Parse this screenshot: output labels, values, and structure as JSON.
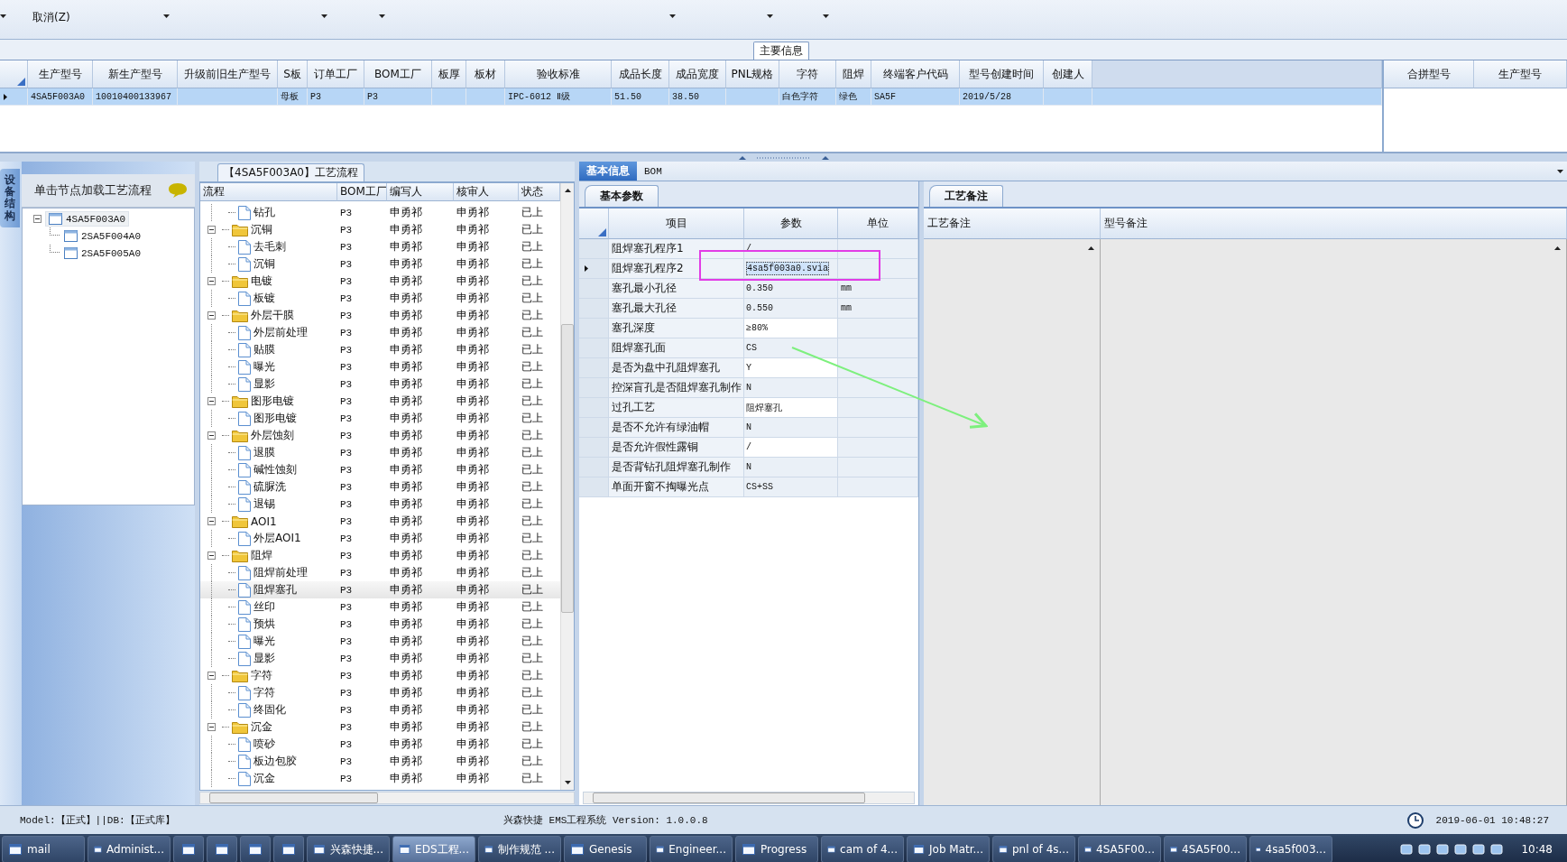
{
  "toolbar": {
    "cancel_label": "取消(Z)"
  },
  "main_info": {
    "title": "主要信息",
    "columns": [
      "生产型号",
      "新生产型号",
      "升级前旧生产型号",
      "S板",
      "订单工厂",
      "BOM工厂",
      "板厚",
      "板材",
      "验收标准",
      "成品长度",
      "成品宽度",
      "PNL规格",
      "字符",
      "阻焊",
      "终端客户代码",
      "型号创建时间",
      "创建人"
    ],
    "rows": [
      {
        "selected": true,
        "cells": [
          "4SA5F003A0",
          "10010400133967",
          null,
          "母板",
          "P3",
          "P3",
          null,
          null,
          "IPC-6012 Ⅱ级",
          "51.50",
          "38.50",
          null,
          "白色字符",
          "绿色",
          "SA5F",
          "2019/5/28",
          null
        ]
      }
    ],
    "merge_columns": [
      "合拼型号",
      "生产型号"
    ]
  },
  "equipment_panel": {
    "side_tab": "设备结构",
    "header": "单击节点加载工艺流程",
    "tree": [
      {
        "label": "4SA5F003A0",
        "expanded": true,
        "selected": true,
        "children": [
          {
            "label": "2SA5F004A0",
            "selected": false
          },
          {
            "label": "2SA5F005A0",
            "selected": false
          }
        ]
      }
    ]
  },
  "process": {
    "title": "【4SA5F003A0】工艺流程",
    "columns": [
      "流程",
      "BOM工厂",
      "编写人",
      "核审人",
      "状态"
    ],
    "nodes": [
      {
        "kind": "step",
        "name": "钻孔",
        "bom": "P3",
        "writer": "申勇祁",
        "reviewer": "申勇祁",
        "status": "已上",
        "selected": false
      },
      {
        "kind": "folder",
        "name": "沉铜",
        "bom": "P3",
        "writer": "申勇祁",
        "reviewer": "申勇祁",
        "status": "已上",
        "selected": false,
        "expanded": true,
        "children": [
          {
            "kind": "step",
            "name": "去毛刺",
            "bom": "P3",
            "writer": "申勇祁",
            "reviewer": "申勇祁",
            "status": "已上",
            "selected": false
          },
          {
            "kind": "step",
            "name": "沉铜",
            "bom": "P3",
            "writer": "申勇祁",
            "reviewer": "申勇祁",
            "status": "已上",
            "selected": false
          }
        ]
      },
      {
        "kind": "folder",
        "name": "电镀",
        "bom": "P3",
        "writer": "申勇祁",
        "reviewer": "申勇祁",
        "status": "已上",
        "selected": false,
        "expanded": true,
        "children": [
          {
            "kind": "step",
            "name": "板镀",
            "bom": "P3",
            "writer": "申勇祁",
            "reviewer": "申勇祁",
            "status": "已上",
            "selected": false
          }
        ]
      },
      {
        "kind": "folder",
        "name": "外层干膜",
        "bom": "P3",
        "writer": "申勇祁",
        "reviewer": "申勇祁",
        "status": "已上",
        "selected": false,
        "expanded": true,
        "children": [
          {
            "kind": "step",
            "name": "外层前处理",
            "bom": "P3",
            "writer": "申勇祁",
            "reviewer": "申勇祁",
            "status": "已上",
            "selected": false
          },
          {
            "kind": "step",
            "name": "贴膜",
            "bom": "P3",
            "writer": "申勇祁",
            "reviewer": "申勇祁",
            "status": "已上",
            "selected": false
          },
          {
            "kind": "step",
            "name": "曝光",
            "bom": "P3",
            "writer": "申勇祁",
            "reviewer": "申勇祁",
            "status": "已上",
            "selected": false
          },
          {
            "kind": "step",
            "name": "显影",
            "bom": "P3",
            "writer": "申勇祁",
            "reviewer": "申勇祁",
            "status": "已上",
            "selected": false
          }
        ]
      },
      {
        "kind": "folder",
        "name": "图形电镀",
        "bom": "P3",
        "writer": "申勇祁",
        "reviewer": "申勇祁",
        "status": "已上",
        "selected": false,
        "expanded": true,
        "children": [
          {
            "kind": "step",
            "name": "图形电镀",
            "bom": "P3",
            "writer": "申勇祁",
            "reviewer": "申勇祁",
            "status": "已上",
            "selected": false
          }
        ]
      },
      {
        "kind": "folder",
        "name": "外层蚀刻",
        "bom": "P3",
        "writer": "申勇祁",
        "reviewer": "申勇祁",
        "status": "已上",
        "selected": false,
        "expanded": true,
        "children": [
          {
            "kind": "step",
            "name": "退膜",
            "bom": "P3",
            "writer": "申勇祁",
            "reviewer": "申勇祁",
            "status": "已上",
            "selected": false
          },
          {
            "kind": "step",
            "name": "碱性蚀刻",
            "bom": "P3",
            "writer": "申勇祁",
            "reviewer": "申勇祁",
            "status": "已上",
            "selected": false
          },
          {
            "kind": "step",
            "name": "硫脲洗",
            "bom": "P3",
            "writer": "申勇祁",
            "reviewer": "申勇祁",
            "status": "已上",
            "selected": false
          },
          {
            "kind": "step",
            "name": "退锡",
            "bom": "P3",
            "writer": "申勇祁",
            "reviewer": "申勇祁",
            "status": "已上",
            "selected": false
          }
        ]
      },
      {
        "kind": "folder",
        "name": "AOI1",
        "bom": "P3",
        "writer": "申勇祁",
        "reviewer": "申勇祁",
        "status": "已上",
        "selected": false,
        "expanded": true,
        "children": [
          {
            "kind": "step",
            "name": "外层AOI1",
            "bom": "P3",
            "writer": "申勇祁",
            "reviewer": "申勇祁",
            "status": "已上",
            "selected": false
          }
        ]
      },
      {
        "kind": "folder",
        "name": "阻焊",
        "bom": "P3",
        "writer": "申勇祁",
        "reviewer": "申勇祁",
        "status": "已上",
        "selected": false,
        "expanded": true,
        "children": [
          {
            "kind": "step",
            "name": "阻焊前处理",
            "bom": "P3",
            "writer": "申勇祁",
            "reviewer": "申勇祁",
            "status": "已上",
            "selected": false
          },
          {
            "kind": "step",
            "name": "阻焊塞孔",
            "bom": "P3",
            "writer": "申勇祁",
            "reviewer": "申勇祁",
            "status": "已上",
            "selected": true
          },
          {
            "kind": "step",
            "name": "丝印",
            "bom": "P3",
            "writer": "申勇祁",
            "reviewer": "申勇祁",
            "status": "已上",
            "selected": false
          },
          {
            "kind": "step",
            "name": "预烘",
            "bom": "P3",
            "writer": "申勇祁",
            "reviewer": "申勇祁",
            "status": "已上",
            "selected": false
          },
          {
            "kind": "step",
            "name": "曝光",
            "bom": "P3",
            "writer": "申勇祁",
            "reviewer": "申勇祁",
            "status": "已上",
            "selected": false
          },
          {
            "kind": "step",
            "name": "显影",
            "bom": "P3",
            "writer": "申勇祁",
            "reviewer": "申勇祁",
            "status": "已上",
            "selected": false
          }
        ]
      },
      {
        "kind": "folder",
        "name": "字符",
        "bom": "P3",
        "writer": "申勇祁",
        "reviewer": "申勇祁",
        "status": "已上",
        "selected": false,
        "expanded": true,
        "children": [
          {
            "kind": "step",
            "name": "字符",
            "bom": "P3",
            "writer": "申勇祁",
            "reviewer": "申勇祁",
            "status": "已上",
            "selected": false
          },
          {
            "kind": "step",
            "name": "终固化",
            "bom": "P3",
            "writer": "申勇祁",
            "reviewer": "申勇祁",
            "status": "已上",
            "selected": false
          }
        ]
      },
      {
        "kind": "folder",
        "name": "沉金",
        "bom": "P3",
        "writer": "申勇祁",
        "reviewer": "申勇祁",
        "status": "已上",
        "selected": false,
        "expanded": true,
        "children": [
          {
            "kind": "step",
            "name": "喷砂",
            "bom": "P3",
            "writer": "申勇祁",
            "reviewer": "申勇祁",
            "status": "已上",
            "selected": false
          },
          {
            "kind": "step",
            "name": "板边包胶",
            "bom": "P3",
            "writer": "申勇祁",
            "reviewer": "申勇祁",
            "status": "已上",
            "selected": false
          },
          {
            "kind": "step",
            "name": "沉金",
            "bom": "P3",
            "writer": "申勇祁",
            "reviewer": "申勇祁",
            "status": "已上",
            "selected": false
          }
        ]
      }
    ]
  },
  "detail": {
    "tabs": [
      {
        "label": "基本信息",
        "selected": true
      },
      {
        "label": "BOM",
        "selected": false
      }
    ],
    "params": {
      "tab": "基本参数",
      "columns": [
        "项目",
        "参数",
        "单位"
      ],
      "rows": [
        {
          "item": "阻焊塞孔程序1",
          "value": "/",
          "editable": false,
          "current": false
        },
        {
          "item": "阻焊塞孔程序2",
          "value": "4sa5f003a0.svia",
          "editable": false,
          "current": true
        },
        {
          "item": "塞孔最小孔径",
          "value": "0.350",
          "unit": "mm",
          "editable": false,
          "current": false
        },
        {
          "item": "塞孔最大孔径",
          "value": "0.550",
          "unit": "mm",
          "editable": false,
          "current": false
        },
        {
          "item": "塞孔深度",
          "value": "≥80%",
          "editable": true,
          "current": false
        },
        {
          "item": "阻焊塞孔面",
          "value": "CS",
          "editable": false,
          "current": false
        },
        {
          "item": "是否为盘中孔阻焊塞孔",
          "value": "Y",
          "editable": true,
          "current": false
        },
        {
          "item": "控深盲孔是否阻焊塞孔制作",
          "value": "N",
          "editable": false,
          "current": false
        },
        {
          "item": "过孔工艺",
          "value": "阻焊塞孔",
          "editable": true,
          "current": false
        },
        {
          "item": "是否不允许有绿油帽",
          "value": "N",
          "editable": false,
          "current": false
        },
        {
          "item": "是否允许假性露铜",
          "value": "/",
          "editable": true,
          "current": false
        },
        {
          "item": "是否背钻孔阻焊塞孔制作",
          "value": "N",
          "editable": false,
          "current": false
        },
        {
          "item": "单面开窗不掏曝光点",
          "value": "CS+SS",
          "editable": false,
          "current": false
        }
      ]
    },
    "notes": {
      "tab": "工艺备注",
      "columns": [
        "工艺备注",
        "型号备注"
      ]
    }
  },
  "status_bar": {
    "left": "Model:【正式】||DB:【正式库】",
    "center": "兴森快捷 EMS工程系统 Version: 1.0.0.8",
    "clock": "2019-06-01 10:48:27"
  },
  "taskbar": {
    "items": [
      {
        "kind": "app",
        "label": "mail",
        "selected": false
      },
      {
        "kind": "app",
        "label": "Administ...",
        "selected": false
      },
      {
        "kind": "icon",
        "selected": false
      },
      {
        "kind": "icon",
        "selected": false
      },
      {
        "kind": "icon",
        "selected": false
      },
      {
        "kind": "icon",
        "selected": false
      },
      {
        "kind": "app",
        "label": "兴森快捷...",
        "selected": false
      },
      {
        "kind": "app",
        "label": "EDS工程...",
        "selected": true
      },
      {
        "kind": "app",
        "label": "制作规范 ...",
        "selected": false
      },
      {
        "kind": "app",
        "label": "Genesis",
        "selected": false
      },
      {
        "kind": "app",
        "label": "Engineer...",
        "selected": false
      },
      {
        "kind": "app",
        "label": "Progress",
        "selected": false
      },
      {
        "kind": "app",
        "label": "cam of 4...",
        "selected": false
      },
      {
        "kind": "app",
        "label": "Job Matr...",
        "selected": false
      },
      {
        "kind": "app",
        "label": "pnl of 4s...",
        "selected": false
      },
      {
        "kind": "app",
        "label": "4SA5F00...",
        "selected": false
      },
      {
        "kind": "app",
        "label": "4SA5F00...",
        "selected": false
      },
      {
        "kind": "app",
        "label": "4sa5f003...",
        "selected": false
      }
    ],
    "time": "10:48"
  }
}
